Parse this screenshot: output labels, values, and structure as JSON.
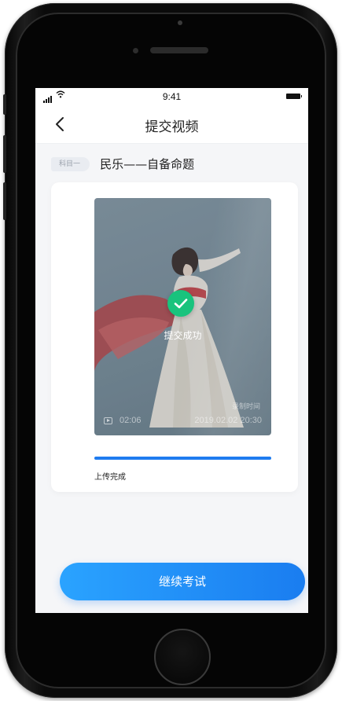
{
  "status_bar": {
    "time": "9:41"
  },
  "nav": {
    "title": "提交视频"
  },
  "subject": {
    "tag": "科目一",
    "title": "民乐——自备命题"
  },
  "video": {
    "success_text": "提交成功",
    "record_label": "录制时间",
    "duration": "02:06",
    "record_time": "2019.02.02 20:30"
  },
  "upload": {
    "progress": 1.0,
    "status": "上传完成"
  },
  "continue_label": "继续考试",
  "colors": {
    "accent": "#1f7cf0",
    "success": "#19c37d"
  }
}
